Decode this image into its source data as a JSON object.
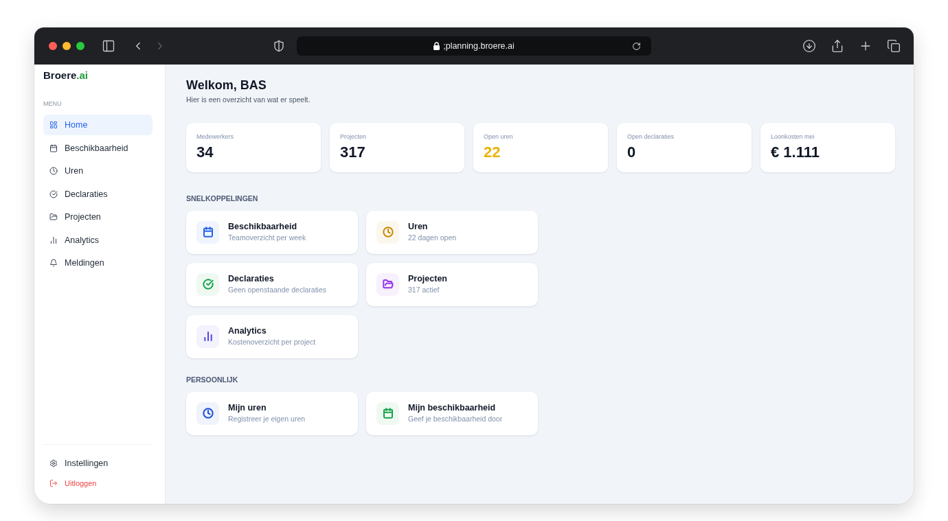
{
  "browser": {
    "url": ";planning.broere.ai",
    "back_disabled": false,
    "forward_disabled": true
  },
  "sidebar": {
    "logo": {
      "name": "Broere",
      "suffix": ".ai"
    },
    "menu_label": "MENU",
    "items": [
      {
        "label": "Home",
        "selected": true
      },
      {
        "label": "Beschikbaarheid",
        "selected": false
      },
      {
        "label": "Uren",
        "selected": false
      },
      {
        "label": "Declaraties",
        "selected": false
      },
      {
        "label": "Projecten",
        "selected": false
      },
      {
        "label": "Analytics",
        "selected": false
      },
      {
        "label": "Meldingen",
        "selected": false
      }
    ],
    "footer_items": [
      {
        "label": "Instellingen",
        "kind": "normal"
      },
      {
        "label": "Uitloggen",
        "kind": "danger"
      }
    ]
  },
  "header": {
    "title": "Welkom, BAS",
    "subtitle": "Hier is een overzicht van wat er speelt."
  },
  "stats": [
    {
      "label": "Medewerkers",
      "value": "34",
      "color": "#111827"
    },
    {
      "label": "Projecten",
      "value": "317",
      "color": "#111827"
    },
    {
      "label": "Open uren",
      "value": "22",
      "color": "#eab308"
    },
    {
      "label": "Open declaraties",
      "value": "0",
      "color": "#111827"
    },
    {
      "label": "Loonkosten mei",
      "value": "€ 1.111",
      "color": "#111827"
    }
  ],
  "sections": [
    {
      "title": "SNELKOPPELINGEN",
      "cards": [
        {
          "title": "Beschikbaarheid",
          "subtitle": "Teamoverzicht per week",
          "color": "#2563eb"
        },
        {
          "title": "Uren",
          "subtitle": "22 dagen open",
          "color": "#ca8a04"
        },
        {
          "title": "Declaraties",
          "subtitle": "Geen openstaande declaraties",
          "color": "#16a34a"
        },
        {
          "title": "Projecten",
          "subtitle": "317 actief",
          "color": "#9333ea"
        },
        {
          "title": "Analytics",
          "subtitle": "Kostenoverzicht per project",
          "color": "#4f46e5"
        }
      ]
    },
    {
      "title": "PERSOONLIJK",
      "cards": [
        {
          "title": "Mijn uren",
          "subtitle": "Registreer je eigen uren",
          "color": "#1d4ed8"
        },
        {
          "title": "Mijn beschikbaarheid",
          "subtitle": "Geef je beschikbaarheid door",
          "color": "#16a34a"
        }
      ]
    }
  ]
}
